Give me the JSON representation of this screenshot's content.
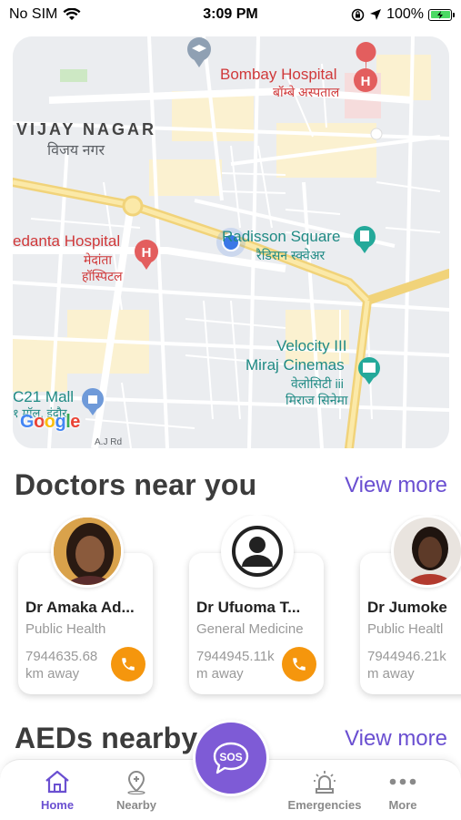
{
  "status_bar": {
    "carrier": "No SIM",
    "time": "3:09 PM",
    "battery": "100%"
  },
  "map": {
    "labels": {
      "bombay_hospital": "Bombay Hospital",
      "bombay_hospital_hi": "बॉम्बे अस्पताल",
      "vijay_nagar": "VIJAY NAGAR",
      "vijay_nagar_hi": "विजय नगर",
      "medanta": "edanta Hospital",
      "medanta_hi_1": "मेदांता",
      "medanta_hi_2": "हॉस्पिटल",
      "radisson": "Radisson Square",
      "radisson_hi": "रैडिसन स्क्वेअर",
      "velocity_1": "Velocity III",
      "velocity_2": "Miraj Cinemas",
      "velocity_hi_1": "वेलोसिटी iii",
      "velocity_hi_2": "मिराज सिनेमा",
      "c21_mall": "C21 Mall",
      "c21_mall_hi": "१ मॉल, इंदौर",
      "google": "Google",
      "road": "A.J Rd"
    }
  },
  "doctors": {
    "title": "Doctors near you",
    "view_more": "View more",
    "items": [
      {
        "name": "Dr Amaka Ad...",
        "specialty": "Public Health",
        "distance_line1": "7944635.68",
        "distance_line2": "km away"
      },
      {
        "name": "Dr Ufuoma  T...",
        "specialty": "General Medicine",
        "distance_line1": "7944945.11k",
        "distance_line2": "m away"
      },
      {
        "name": "Dr Jumoke",
        "specialty": "Public Healtl",
        "distance_line1": "7944946.21k",
        "distance_line2": "m away"
      }
    ]
  },
  "aeds": {
    "title": "AEDs nearby",
    "view_more": "View more"
  },
  "tabbar": {
    "home": "Home",
    "nearby": "Nearby",
    "sos": "SOS",
    "emergencies": "Emergencies",
    "more": "More"
  },
  "colors": {
    "accent": "#6a4fd1",
    "call": "#f5960d",
    "sos": "#7e5bd6"
  }
}
